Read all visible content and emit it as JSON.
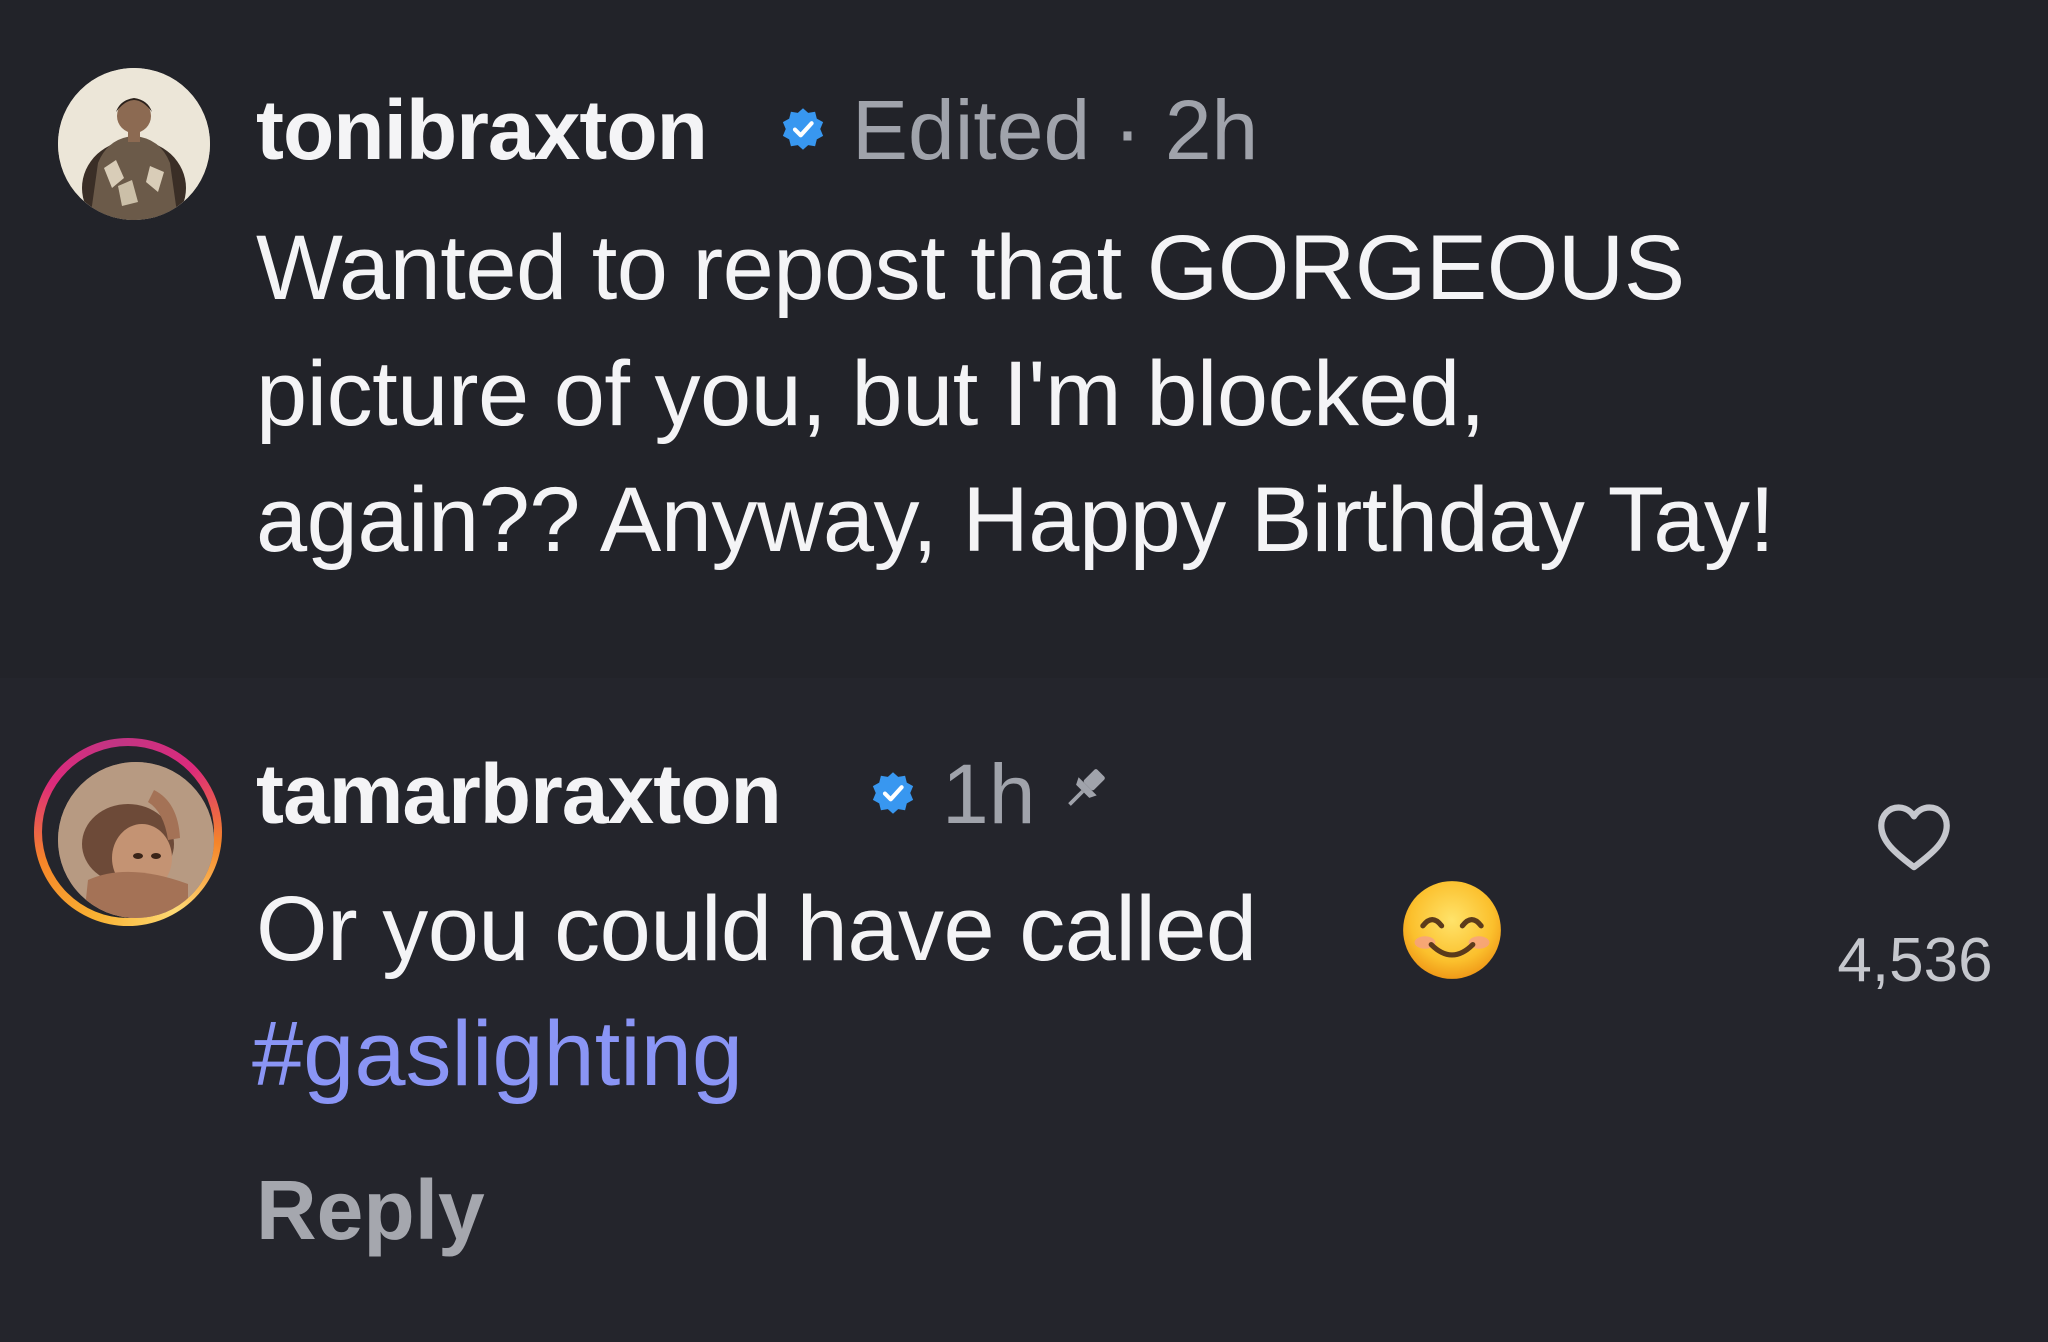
{
  "comments": [
    {
      "username": "tonibraxton",
      "meta": "Edited · 2h",
      "lines": [
        "Wanted to repost that GORGEOUS",
        "picture of you, but I'm blocked,",
        "again?? Anyway, Happy Birthday Tay!"
      ],
      "verified": true
    },
    {
      "username": "tamarbraxton",
      "time": "1h",
      "pinned": true,
      "verified": true,
      "text": "Or you could have called",
      "emoji": "smiling-face-with-smiling-eyes",
      "hashtag": "#gaslighting",
      "reply_label": "Reply",
      "like_count": "4,536"
    }
  ],
  "colors": {
    "background": "#222329",
    "text": "#f4f4f6",
    "meta": "#a0a3ab",
    "verified": "#3897f0",
    "hashtag": "#8a95f5"
  }
}
